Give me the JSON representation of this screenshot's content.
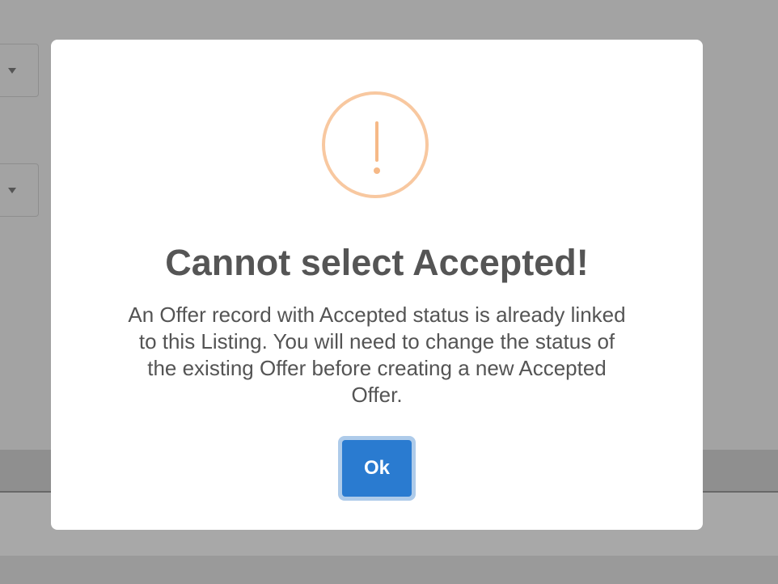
{
  "dialog": {
    "title": "Cannot select Accepted!",
    "message": "An Offer record with Accepted status is already linked to this Listing. You will need to change the status of the existing Offer before creating a new Accepted Offer.",
    "icon": "warning-icon",
    "ok_label": "Ok"
  },
  "colors": {
    "overlay": "#a3a3a3",
    "warning": "#f8bb86",
    "button": "#2a7bd0",
    "title_text": "#555555"
  }
}
